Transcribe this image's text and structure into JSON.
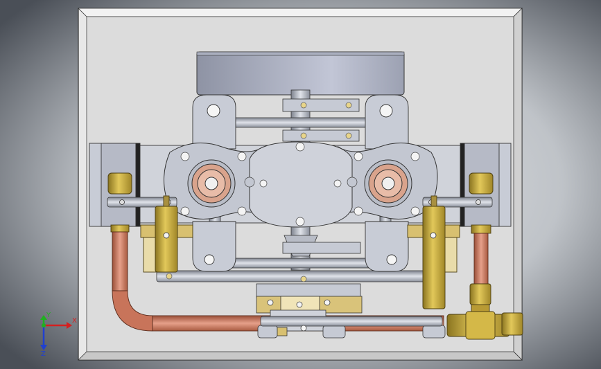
{
  "triad": {
    "x_label": "X",
    "y_label": "Y",
    "z_label": "Z"
  },
  "colors": {
    "background_dark": "#4a4f57",
    "background_light": "#c9ccd0",
    "frame_outer": "#e6e6e6",
    "frame_inner": "#d9d9d9",
    "steel": "#c6cad4",
    "steel_dark": "#8d929c",
    "brass": "#c8aa3c",
    "brass_light": "#e8d58a",
    "copper": "#c8745a",
    "copper_light": "#e6a08a",
    "axis_x": "#d42020",
    "axis_y": "#20b020",
    "axis_z": "#2040d0"
  }
}
